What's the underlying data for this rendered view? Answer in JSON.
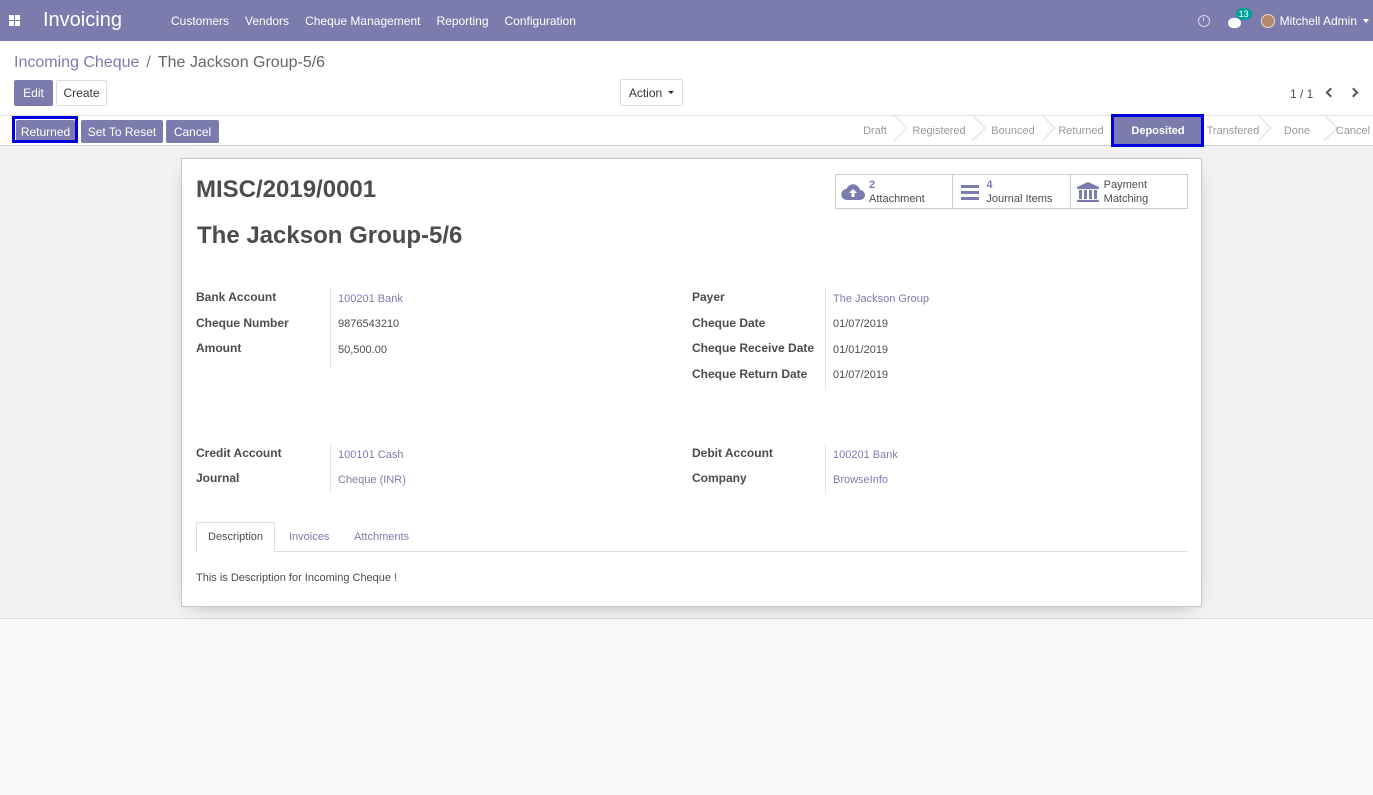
{
  "navbar": {
    "brand": "Invoicing",
    "menu": [
      "Customers",
      "Vendors",
      "Cheque Management",
      "Reporting",
      "Configuration"
    ],
    "chat_count": "13",
    "user_name": "Mitchell Admin"
  },
  "breadcrumb": {
    "parent": "Incoming Cheque",
    "separator": "/",
    "current": "The Jackson Group-5/6"
  },
  "toolbar": {
    "edit_label": "Edit",
    "create_label": "Create",
    "action_label": "Action",
    "pager": "1 / 1"
  },
  "statusbar": {
    "buttons": [
      "Returned",
      "Set To Reset",
      "Cancel"
    ],
    "stages": [
      "Draft",
      "Registered",
      "Bounced",
      "Returned",
      "Deposited",
      "Transfered",
      "Done",
      "Cancel"
    ],
    "active_stage": "Deposited"
  },
  "record": {
    "reference": "MISC/2019/0001",
    "title": "The Jackson Group-5/6"
  },
  "smart_buttons": [
    {
      "icon": "cloud-upload-icon",
      "count": "2",
      "label": "Attachment"
    },
    {
      "icon": "list-icon",
      "count": "4",
      "label": "Journal Items"
    },
    {
      "icon": "bank-icon",
      "label": "Payment",
      "label2": "Matching"
    }
  ],
  "fields_left": [
    {
      "label": "Bank Account",
      "value": "100201 Bank",
      "link": true
    },
    {
      "label": "Cheque Number",
      "value": "9876543210",
      "link": false
    },
    {
      "label": "Amount",
      "value": "50,500.00",
      "link": false
    }
  ],
  "fields_right": [
    {
      "label": "Payer",
      "value": "The Jackson Group",
      "link": true
    },
    {
      "label": "Cheque Date",
      "value": "01/07/2019",
      "link": false
    },
    {
      "label": "Cheque Receive Date",
      "value": "01/01/2019",
      "link": false
    },
    {
      "label": "Cheque Return Date",
      "value": "01/07/2019",
      "link": false
    }
  ],
  "fields_left2": [
    {
      "label": "Credit Account",
      "value": "100101 Cash",
      "link": true
    },
    {
      "label": "Journal",
      "value": "Cheque (INR)",
      "link": true
    }
  ],
  "fields_right2": [
    {
      "label": "Debit Account",
      "value": "100201 Bank",
      "link": true
    },
    {
      "label": "Company",
      "value": "BrowseInfo",
      "link": true
    }
  ],
  "tabs": [
    "Description",
    "Invoices",
    "Attchments"
  ],
  "description": "This is Description for Incoming Cheque !",
  "colors": {
    "accent": "#7c7bad",
    "highlight": "#0000e0"
  }
}
